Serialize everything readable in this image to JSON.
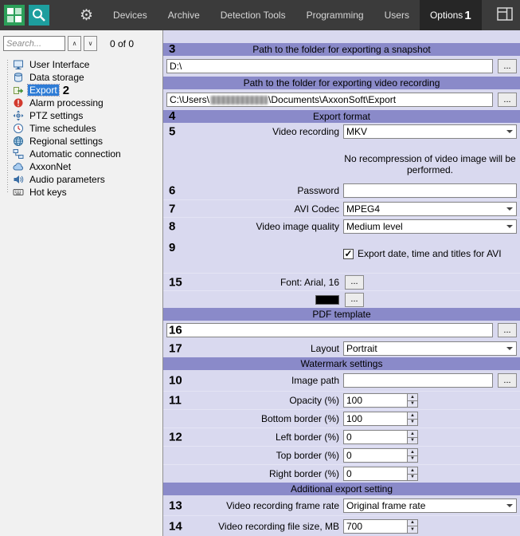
{
  "annotations": {
    "1": "1",
    "2": "2",
    "3": "3",
    "4": "4",
    "5": "5",
    "6": "6",
    "7": "7",
    "8": "8",
    "9": "9",
    "10": "10",
    "11": "11",
    "12": "12",
    "13": "13",
    "14": "14",
    "15": "15",
    "16": "16",
    "17": "17"
  },
  "colors": {
    "topbar_bg": "#3b3b3b",
    "section_band": "#8a8ac9",
    "panel_bg": "#d9d9ef",
    "selection_blue": "#2e7cd6"
  },
  "topbar": {
    "menu": [
      {
        "label": "Devices"
      },
      {
        "label": "Archive"
      },
      {
        "label": "Detection Tools"
      },
      {
        "label": "Programming"
      },
      {
        "label": "Users"
      },
      {
        "label": "Options"
      }
    ]
  },
  "sidebar": {
    "search_placeholder": "Search...",
    "result_count": "0 of 0",
    "items": [
      {
        "label": "User Interface"
      },
      {
        "label": "Data storage"
      },
      {
        "label": "Export"
      },
      {
        "label": "Alarm processing"
      },
      {
        "label": "PTZ settings"
      },
      {
        "label": "Time schedules"
      },
      {
        "label": "Regional settings"
      },
      {
        "label": "Automatic connection"
      },
      {
        "label": "AxxonNet"
      },
      {
        "label": "Audio parameters"
      },
      {
        "label": "Hot keys"
      }
    ]
  },
  "panel": {
    "browse_label": "...",
    "snapshot": {
      "header": "Path to the folder for exporting a snapshot",
      "path": "D:\\"
    },
    "video_export": {
      "header": "Path to the folder for exporting video recording",
      "path_prefix": "C:\\Users\\",
      "path_suffix": "\\Documents\\AxxonSoft\\Export"
    },
    "export_format": {
      "header": "Export format",
      "video_recording_label": "Video recording",
      "video_recording_value": "MKV",
      "note": "No recompression of video image will be performed.",
      "password_label": "Password",
      "password_value": "",
      "avi_codec_label": "AVI Codec",
      "avi_codec_value": "MPEG4",
      "quality_label": "Video image quality",
      "quality_value": "Medium level",
      "date_checkbox_label": "Export date, time and titles for AVI",
      "font_label": "Font: Arial, 16"
    },
    "pdf": {
      "header": "PDF template",
      "template_path": "",
      "layout_label": "Layout",
      "layout_value": "Portrait"
    },
    "watermark": {
      "header": "Watermark settings",
      "image_path_label": "Image path",
      "image_path": "",
      "opacity_label": "Opacity (%)",
      "opacity": "100",
      "bottom_border_label": "Bottom border (%)",
      "bottom_border": "100",
      "left_border_label": "Left border (%)",
      "left_border": "0",
      "top_border_label": "Top border (%)",
      "top_border": "0",
      "right_border_label": "Right border (%)",
      "right_border": "0"
    },
    "additional": {
      "header": "Additional export setting",
      "frame_rate_label": "Video recording frame rate",
      "frame_rate_value": "Original frame rate",
      "file_size_label": "Video recording file size, MB",
      "file_size": "700"
    }
  }
}
